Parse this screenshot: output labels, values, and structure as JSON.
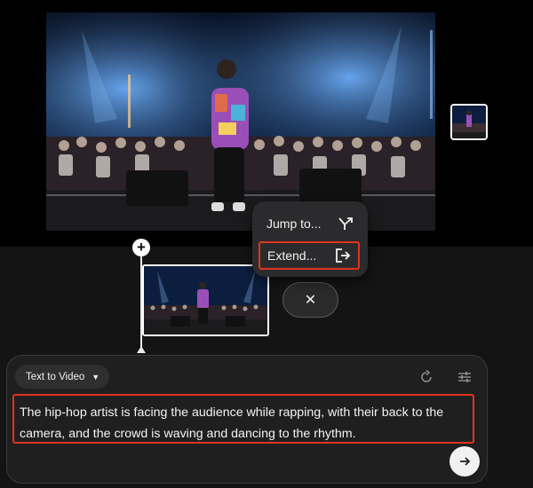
{
  "menu": {
    "jump_label": "Jump to...",
    "extend_label": "Extend..."
  },
  "timeline": {
    "add_symbol": "+",
    "close_symbol": "✕"
  },
  "prompt": {
    "mode_label": "Text to Video",
    "text": "The hip-hop artist is facing the audience while rapping, with their back to the camera, and the crowd is waving and dancing to the rhythm."
  },
  "icons": {
    "jump": "jump-arrow-icon",
    "extend": "extend-exit-icon",
    "refresh": "refresh-icon",
    "settings": "sliders-icon",
    "send": "arrow-right-icon",
    "close": "close-icon",
    "add": "plus-icon"
  },
  "colors": {
    "highlight": "#e0331e",
    "stage_blue": "#3f7fd6"
  }
}
